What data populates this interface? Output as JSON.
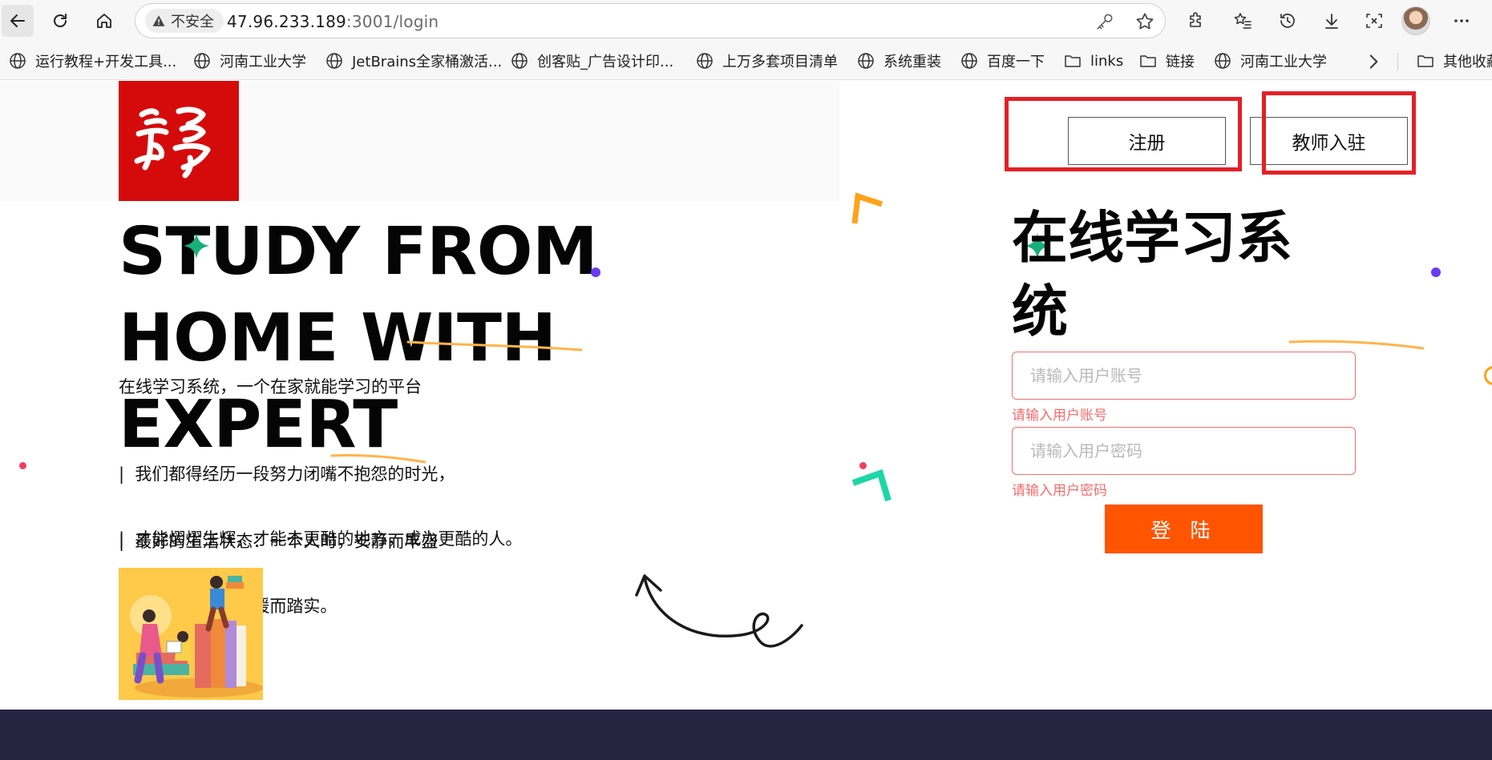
{
  "browser": {
    "security_label": "不安全",
    "url_host": "47.96.233.189",
    "url_path": ":3001/login"
  },
  "bookmarks": [
    {
      "label": "运行教程+开发工具...",
      "icon": "globe-icon"
    },
    {
      "label": "河南工业大学",
      "icon": "globe-icon"
    },
    {
      "label": "JetBrains全家桶激活...",
      "icon": "globe-icon"
    },
    {
      "label": "创客贴_广告设计印...",
      "icon": "globe-icon"
    },
    {
      "label": "上万多套项目清单",
      "icon": "globe-icon"
    },
    {
      "label": "系统重装",
      "icon": "globe-icon"
    },
    {
      "label": "百度一下",
      "icon": "globe-icon"
    },
    {
      "label": "links",
      "icon": "folder-icon"
    },
    {
      "label": "链接",
      "icon": "folder-icon"
    },
    {
      "label": "河南工业大学",
      "icon": "globe-icon"
    },
    {
      "label": "其他收藏",
      "icon": "folder-icon"
    }
  ],
  "header": {
    "register_label": "注册",
    "teacher_label": "教师入驻"
  },
  "hero": {
    "title_line1": "STUDY FROM",
    "title_line2": "HOME WITH EXPERT",
    "subtitle": "在线学习系统，一个在家就能学习的平台",
    "quote1_line1": "|  我们都得经历一段努力闭嘴不抱怨的时光，",
    "quote1_line2": "|  才能熠熠生辉，才能去更酷的地方，成为更酷的人。",
    "quote2_line1": "|  最好的生活状态：一个人时，安静而丰盛",
    "quote2_line2": "|  ；两个人是，温暖而踏实。"
  },
  "login": {
    "title_line1": "在线学习系",
    "title_line2": "统",
    "username_placeholder": "请输入用户账号",
    "username_value": "",
    "username_error": "请输入用户账号",
    "password_placeholder": "请输入用户密码",
    "password_value": "",
    "password_error": "请输入用户密码",
    "submit_label": "登 陆"
  },
  "colors": {
    "logo_red": "#d50b0b",
    "annotation_red": "#e32026",
    "login_orange": "#ff5400",
    "error_red": "#f56c6c",
    "footer_navy": "#252540"
  }
}
